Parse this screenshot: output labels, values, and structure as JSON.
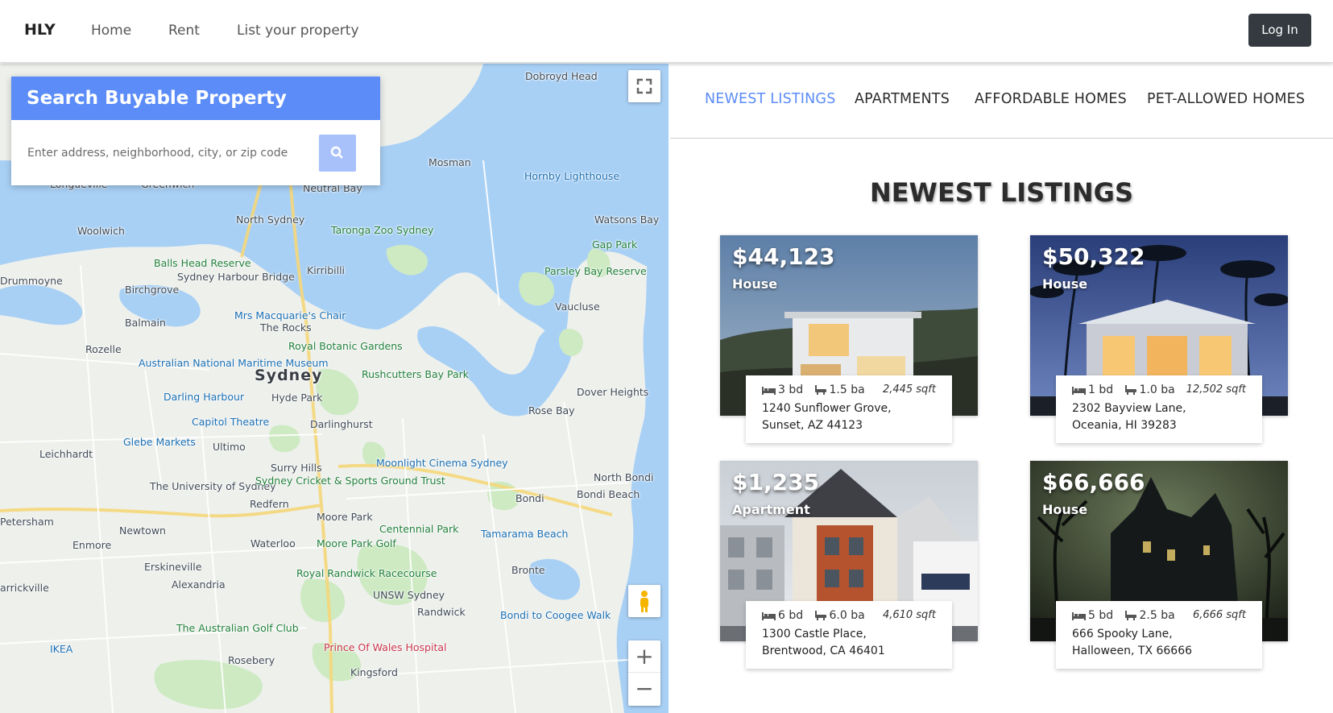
{
  "navbar": {
    "brand": "HLY",
    "links": [
      "Home",
      "Rent",
      "List your property"
    ],
    "login": "Log In"
  },
  "search": {
    "title": "Search Buyable Property",
    "placeholder": "Enter address, neighborhood, city, or zip code"
  },
  "map": {
    "labels": [
      "Dobroyd Head",
      "Mosman",
      "Hornby Lighthouse",
      "Longueville",
      "Greenwich",
      "Neutral Bay",
      "North Sydney",
      "Watsons Bay",
      "Woolwich",
      "Taronga Zoo Sydney",
      "Gap Park",
      "Balls Head Reserve",
      "Kirribilli",
      "Drummoyne",
      "Sydney Harbour Bridge",
      "Parsley Bay Reserve",
      "Birchgrove",
      "Vaucluse",
      "Mrs Macquarie's Chair",
      "Balmain",
      "The Rocks",
      "Royal Botanic Gardens",
      "Rozelle",
      "Australian National Maritime Museum",
      "Sydney",
      "Rushcutters Bay Park",
      "Dover Heights",
      "Darling Harbour",
      "Hyde Park",
      "Rose Bay",
      "Capitol Theatre",
      "Darlinghurst",
      "Glebe Markets",
      "Ultimo",
      "Leichhardt",
      "Moonlight Cinema Sydney",
      "North Bondi",
      "Surry Hills",
      "The University of Sydney",
      "Sydney Cricket & Sports Ground Trust",
      "Bondi Beach",
      "Bondi",
      "Redfern",
      "Moore Park",
      "Petersham",
      "Newtown",
      "Centennial Park",
      "Tamarama Beach",
      "Enmore",
      "Waterloo",
      "Moore Park Golf",
      "Erskineville",
      "Bronte",
      "Royal Randwick Racecourse",
      "Alexandria",
      "arrickville",
      "UNSW Sydney",
      "Randwick",
      "Bondi to Coogee Walk",
      "The Australian Golf Club",
      "Prince Of Wales Hospital",
      "IKEA",
      "Rosebery",
      "Kingsford"
    ],
    "controls": {
      "zoom_in": "+",
      "zoom_out": "−"
    }
  },
  "tabs": [
    "NEWEST LISTINGS",
    "APARTMENTS",
    "AFFORDABLE HOMES",
    "PET-ALLOWED HOMES"
  ],
  "active_tab": "NEWEST LISTINGS",
  "section_title": "NEWEST LISTINGS",
  "listings": [
    {
      "price": "$44,123",
      "type": "House",
      "beds": "3 bd",
      "baths": "1.5 ba",
      "sqft": "2,445 sqft",
      "address_line1": "1240 Sunflower Grove,",
      "address_line2": "Sunset, AZ 44123"
    },
    {
      "price": "$50,322",
      "type": "House",
      "beds": "1 bd",
      "baths": "1.0 ba",
      "sqft": "12,502 sqft",
      "address_line1": "2302 Bayview Lane,",
      "address_line2": "Oceania, HI 39283"
    },
    {
      "price": "$1,235",
      "type": "Apartment",
      "beds": "6 bd",
      "baths": "6.0 ba",
      "sqft": "4,610 sqft",
      "address_line1": "1300 Castle Place,",
      "address_line2": "Brentwood, CA 46401"
    },
    {
      "price": "$66,666",
      "type": "House",
      "beds": "5 bd",
      "baths": "2.5 ba",
      "sqft": "6,666 sqft",
      "address_line1": "666 Spooky Lane,",
      "address_line2": "Halloween, TX 66666"
    }
  ],
  "colors": {
    "accent": "#5b8cf7",
    "search_button": "#a9c1fb",
    "login_bg": "#343a40",
    "water": "#a8d0f5",
    "park": "#cdeac2"
  }
}
